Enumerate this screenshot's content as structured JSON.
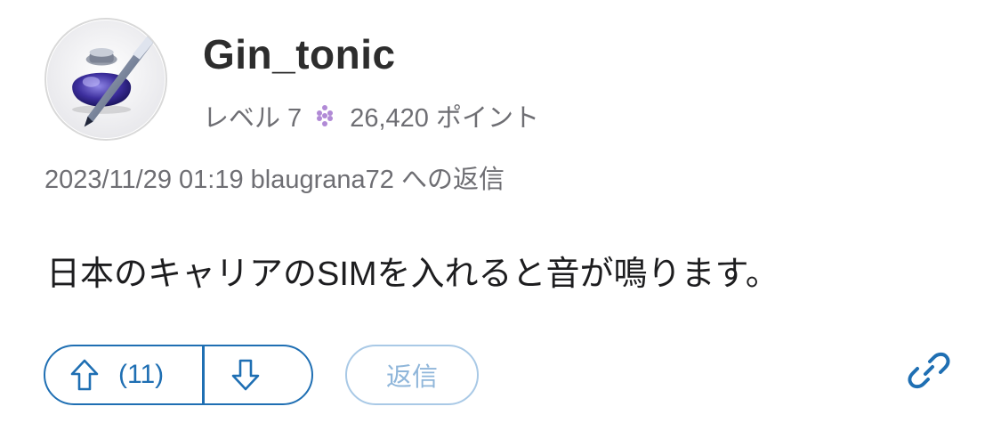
{
  "post": {
    "username": "Gin_tonic",
    "level_label": "レベル 7",
    "points_label": "26,420 ポイント",
    "reply_meta": "2023/11/29 01:19 blaugrana72 への返信",
    "body": "日本のキャリアのSIMを入れると音が鳴ります。"
  },
  "actions": {
    "upvote_count": "(11)",
    "reply_label": "返信"
  },
  "icons": {
    "avatar": "ink-bottle-quill-avatar",
    "level": "level-dots-icon",
    "upvote": "arrow-up-icon",
    "downvote": "arrow-down-icon",
    "link": "link-icon"
  },
  "colors": {
    "accent": "#1f6fb3",
    "accent_light": "#a9c9e6",
    "level_dots": "#b18ad6",
    "meta_text": "#6e6e73"
  }
}
